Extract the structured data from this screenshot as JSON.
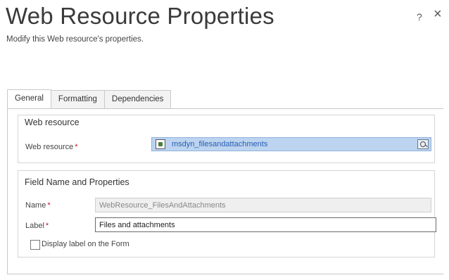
{
  "dialog": {
    "title": "Web Resource Properties",
    "subtitle": "Modify this Web resource's properties.",
    "help_label": "?",
    "close_label": "×"
  },
  "tabs": [
    {
      "label": "General",
      "active": true
    },
    {
      "label": "Formatting",
      "active": false
    },
    {
      "label": "Dependencies",
      "active": false
    }
  ],
  "web_resource_section": {
    "title": "Web resource",
    "field_label": "Web resource",
    "required_mark": "*",
    "value": "msdyn_filesandattachments",
    "icon": "web-resource-icon",
    "lookup_icon": "lookup-search-icon"
  },
  "field_section": {
    "title": "Field Name and Properties",
    "name_label": "Name",
    "name_value": "WebResource_FilesAndAttachments",
    "label_label": "Label",
    "label_value": "Files and attachments",
    "required_mark": "*",
    "checkbox_label": "Display label on the Form",
    "checkbox_checked": false
  },
  "colors": {
    "required": "#c8102e",
    "lookup_highlight": "#bcd4f0",
    "lookup_text": "#2a5db0"
  }
}
